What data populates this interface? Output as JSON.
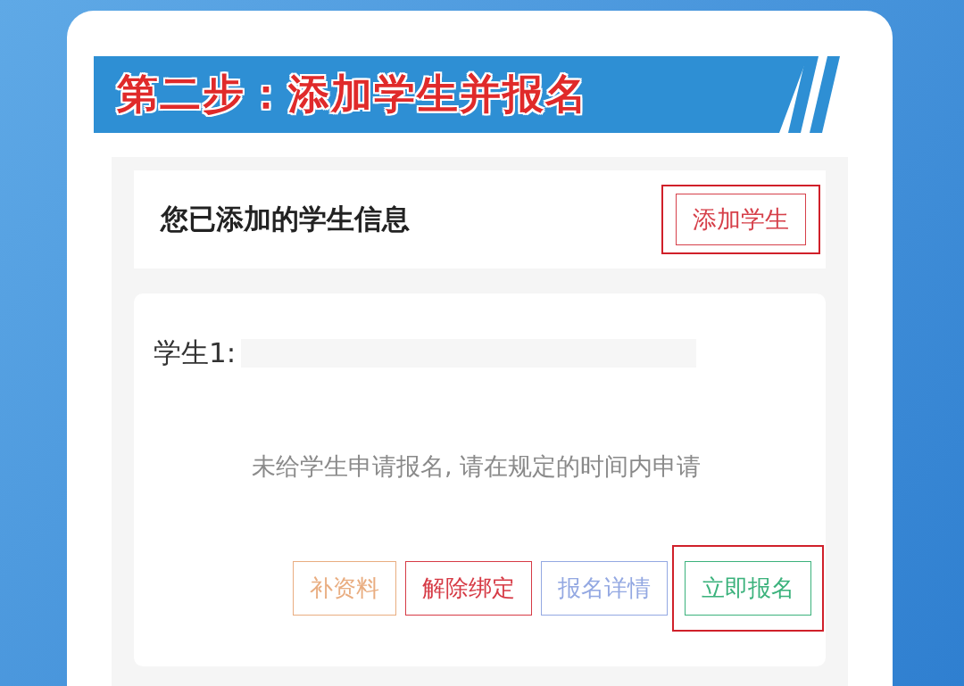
{
  "banner": {
    "title": "第二步：添加学生并报名"
  },
  "header": {
    "title": "您已添加的学生信息",
    "add_button": {
      "label": "添加学生",
      "highlighted": true
    }
  },
  "student": {
    "label": "学生1:",
    "message": "未给学生申请报名, 请在规定的时间内申请",
    "buttons": [
      {
        "label": "补资料",
        "color": "#e9ad80",
        "highlighted": false
      },
      {
        "label": "解除绑定",
        "color": "#d63a45",
        "highlighted": false
      },
      {
        "label": "报名详情",
        "color": "#93a8e2",
        "highlighted": false
      },
      {
        "label": "立即报名",
        "color": "#3bb27c",
        "highlighted": true
      }
    ]
  }
}
